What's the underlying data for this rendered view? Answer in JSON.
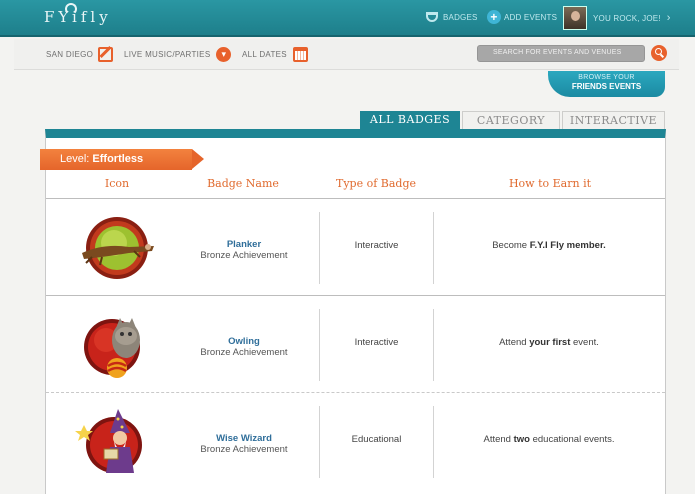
{
  "header": {
    "logo": "FYifly",
    "nav": {
      "badges": "BADGES",
      "add_events": "ADD EVENTS",
      "user_greeting": "YOU ROCK, JOE!"
    }
  },
  "filters": {
    "city": "SAN DIEGO",
    "category": "LIVE MUSIC/PARTIES",
    "dates": "ALL DATES",
    "search_placeholder": "SEARCH FOR EVENTS AND VENUES"
  },
  "friends_tab": {
    "line1": "BROWSE YOUR",
    "line2": "FRIENDS EVENTS"
  },
  "tabs": [
    {
      "label": "ALL BADGES",
      "active": true
    },
    {
      "label": "CATEGORY",
      "active": false
    },
    {
      "label": "INTERACTIVE",
      "active": false
    }
  ],
  "level": {
    "prefix": "Level: ",
    "name": "Effortless"
  },
  "columns": {
    "icon": "Icon",
    "name": "Badge Name",
    "type": "Type of Badge",
    "earn": "How to Earn it"
  },
  "badges": [
    {
      "name": "Planker",
      "tier": "Bronze Achievement",
      "type": "Interactive",
      "earn_pre": "Become ",
      "earn_bold": "F.Y.I Fly member.",
      "earn_post": "",
      "icon": "planker-badge-icon"
    },
    {
      "name": "Owling",
      "tier": "Bronze Achievement",
      "type": "Interactive",
      "earn_pre": "Attend ",
      "earn_bold": "your first",
      "earn_post": " event.",
      "icon": "owling-badge-icon"
    },
    {
      "name": "Wise Wizard",
      "tier": "Bronze Achievement",
      "type": "Educational",
      "earn_pre": "Attend ",
      "earn_bold": "two",
      "earn_post": " educational events.",
      "icon": "wizard-badge-icon"
    }
  ],
  "colors": {
    "teal": "#1e8594",
    "orange": "#e8612c",
    "link_blue": "#2f6e9a"
  }
}
